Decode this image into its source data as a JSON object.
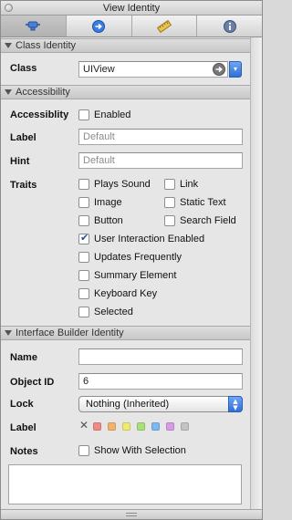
{
  "window": {
    "title": "View Identity"
  },
  "toolbar": {
    "tabs": [
      {
        "icon": "connector-icon",
        "selected": true
      },
      {
        "icon": "arrow-circle-icon",
        "selected": false
      },
      {
        "icon": "ruler-icon",
        "selected": false
      },
      {
        "icon": "info-icon",
        "selected": false
      }
    ]
  },
  "class_identity": {
    "header": "Class Identity",
    "class_label": "Class",
    "class_value": "UIView"
  },
  "accessibility": {
    "header": "Accessibility",
    "accessibility_label": "Accessiblity",
    "enabled_label": "Enabled",
    "enabled_checked": false,
    "label_label": "Label",
    "label_placeholder": "Default",
    "hint_label": "Hint",
    "hint_placeholder": "Default",
    "traits_label": "Traits",
    "traits": [
      {
        "label": "Plays Sound",
        "checked": false
      },
      {
        "label": "Link",
        "checked": false
      },
      {
        "label": "Image",
        "checked": false
      },
      {
        "label": "Static Text",
        "checked": false
      },
      {
        "label": "Button",
        "checked": false
      },
      {
        "label": "Search Field",
        "checked": false
      },
      {
        "label": "User Interaction Enabled",
        "checked": true
      },
      {
        "label": "Updates Frequently",
        "checked": false
      },
      {
        "label": "Summary Element",
        "checked": false
      },
      {
        "label": "Keyboard Key",
        "checked": false
      },
      {
        "label": "Selected",
        "checked": false
      }
    ]
  },
  "ib_identity": {
    "header": "Interface Builder Identity",
    "name_label": "Name",
    "name_value": "",
    "object_id_label": "Object ID",
    "object_id_value": "6",
    "lock_label": "Lock",
    "lock_value": "Nothing (Inherited)",
    "label_label": "Label",
    "label_colors": [
      "#f08a86",
      "#f2b26d",
      "#eeea72",
      "#a8e07a",
      "#7fb7f2",
      "#d79ae4",
      "#c3c3c3"
    ],
    "notes_label": "Notes",
    "show_with_selection_label": "Show With Selection",
    "show_with_selection_checked": false
  }
}
